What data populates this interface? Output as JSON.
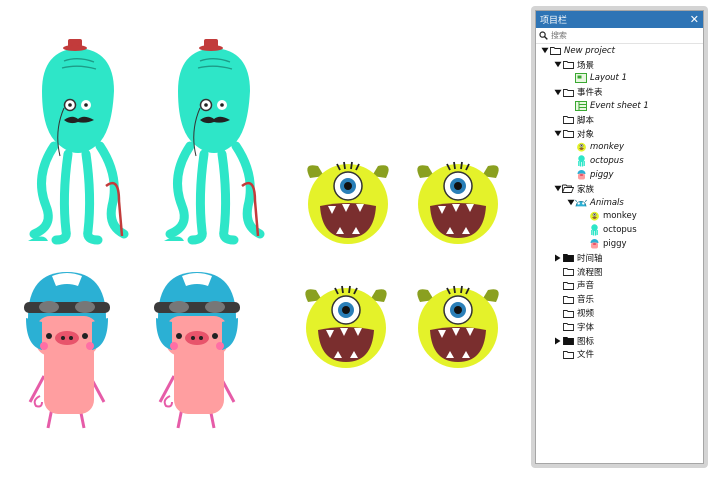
{
  "panel": {
    "title": "项目栏",
    "close_icon": "close-icon",
    "search_placeholder": "搜索"
  },
  "tree": [
    {
      "label": "New project",
      "level": 0,
      "toggle": "expanded",
      "icon": "folder-icon",
      "italic": true
    },
    {
      "label": "场景",
      "level": 1,
      "toggle": "expanded",
      "icon": "folder-icon",
      "italic": false
    },
    {
      "label": "Layout 1",
      "level": 2,
      "toggle": "none",
      "icon": "layout-icon",
      "italic": true
    },
    {
      "label": "事件表",
      "level": 1,
      "toggle": "expanded",
      "icon": "folder-icon",
      "italic": false
    },
    {
      "label": "Event sheet 1",
      "level": 2,
      "toggle": "none",
      "icon": "event-sheet-icon",
      "italic": true
    },
    {
      "label": "脚本",
      "level": 1,
      "toggle": "none",
      "icon": "folder-icon",
      "italic": false
    },
    {
      "label": "对象",
      "level": 1,
      "toggle": "expanded",
      "icon": "folder-icon",
      "italic": false
    },
    {
      "label": "monkey",
      "level": 2,
      "toggle": "none",
      "icon": "monkey-icon",
      "italic": true
    },
    {
      "label": "octopus",
      "level": 2,
      "toggle": "none",
      "icon": "octopus-icon",
      "italic": true
    },
    {
      "label": "piggy",
      "level": 2,
      "toggle": "none",
      "icon": "piggy-icon",
      "italic": true
    },
    {
      "label": "家族",
      "level": 1,
      "toggle": "expanded",
      "icon": "folder-open-icon",
      "italic": false
    },
    {
      "label": "Animals",
      "level": 2,
      "toggle": "expanded",
      "icon": "family-icon",
      "italic": true
    },
    {
      "label": "monkey",
      "level": 3,
      "toggle": "none",
      "icon": "monkey-icon",
      "italic": false
    },
    {
      "label": "octopus",
      "level": 3,
      "toggle": "none",
      "icon": "octopus-icon",
      "italic": false
    },
    {
      "label": "piggy",
      "level": 3,
      "toggle": "none",
      "icon": "piggy-icon",
      "italic": false
    },
    {
      "label": "时间轴",
      "level": 1,
      "toggle": "collapsed",
      "icon": "folder-filled-icon",
      "italic": false
    },
    {
      "label": "流程图",
      "level": 1,
      "toggle": "none",
      "icon": "folder-icon",
      "italic": false
    },
    {
      "label": "声音",
      "level": 1,
      "toggle": "none",
      "icon": "folder-icon",
      "italic": false
    },
    {
      "label": "音乐",
      "level": 1,
      "toggle": "none",
      "icon": "folder-icon",
      "italic": false
    },
    {
      "label": "视频",
      "level": 1,
      "toggle": "none",
      "icon": "folder-icon",
      "italic": false
    },
    {
      "label": "字体",
      "level": 1,
      "toggle": "none",
      "icon": "folder-icon",
      "italic": false
    },
    {
      "label": "图标",
      "level": 1,
      "toggle": "collapsed",
      "icon": "folder-filled-icon",
      "italic": false
    },
    {
      "label": "文件",
      "level": 1,
      "toggle": "none",
      "icon": "folder-icon",
      "italic": false
    }
  ],
  "colors": {
    "titlebar": "#2e74b5",
    "octopus": "#2ee6c8",
    "monkey": "#e4f22a",
    "monkey_mouth": "#7a2e2e",
    "piggy": "#ff9ea0",
    "helmet": "#2bb0d4"
  }
}
